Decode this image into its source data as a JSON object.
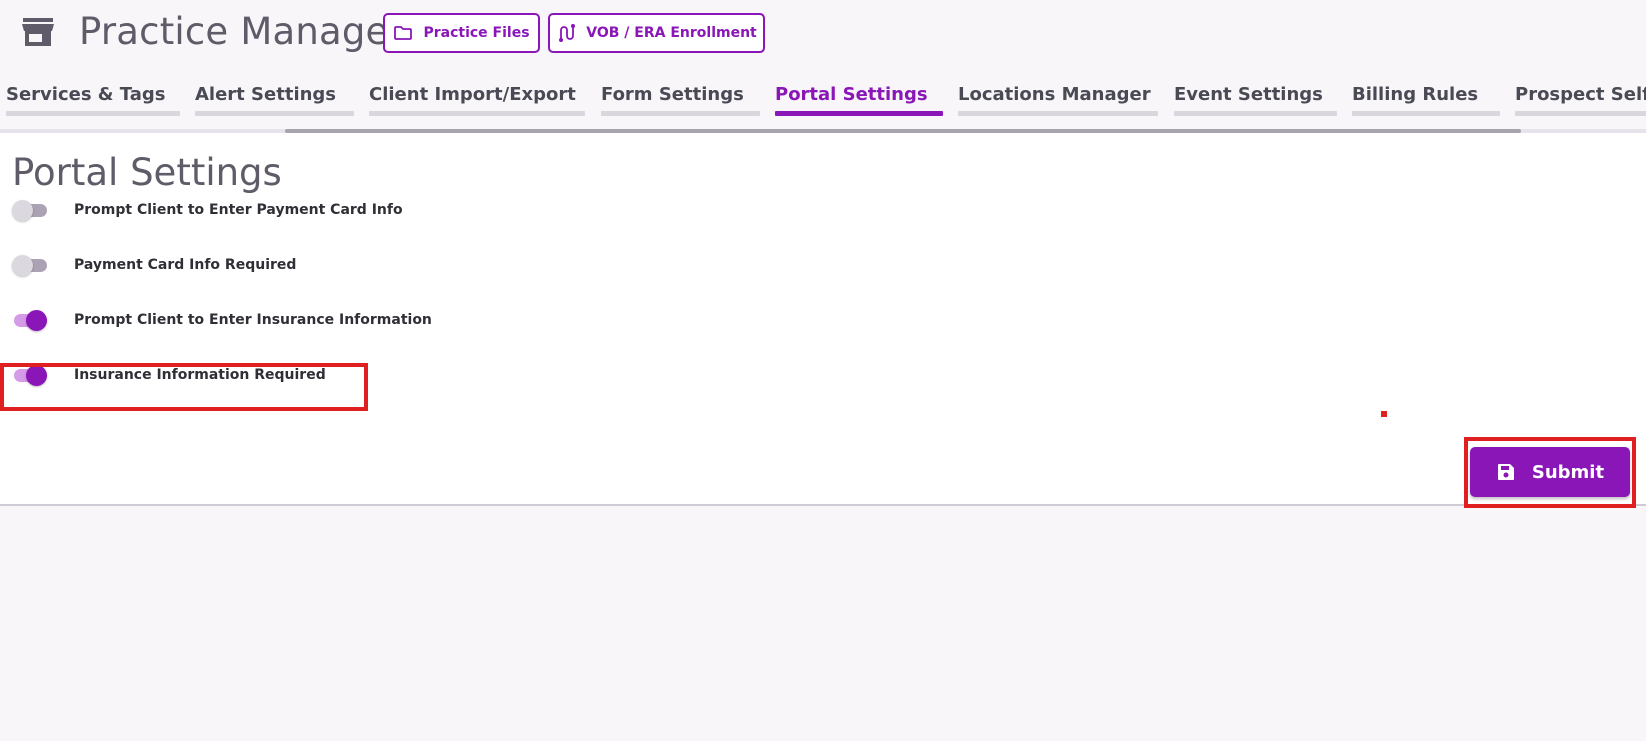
{
  "header": {
    "icon": "store-icon",
    "title": "Practice Manager",
    "buttons": [
      {
        "label": "Practice Files",
        "icon": "folder-icon"
      },
      {
        "label": "VOB / ERA Enrollment",
        "icon": "route-icon"
      }
    ]
  },
  "tabs": {
    "active": "Portal Settings",
    "items": [
      {
        "label": "Services & Tags"
      },
      {
        "label": "Alert Settings"
      },
      {
        "label": "Client Import/Export"
      },
      {
        "label": "Form Settings"
      },
      {
        "label": "Portal Settings"
      },
      {
        "label": "Locations Manager"
      },
      {
        "label": "Event Settings"
      },
      {
        "label": "Billing Rules"
      },
      {
        "label": "Prospect Self S"
      }
    ]
  },
  "main": {
    "title": "Portal Settings",
    "settings": [
      {
        "label": "Prompt Client to Enter Payment Card Info",
        "on": false
      },
      {
        "label": "Payment Card Info Required",
        "on": false
      },
      {
        "label": "Prompt Client to Enter Insurance Information",
        "on": true
      },
      {
        "label": "Insurance Information Required",
        "on": true
      }
    ],
    "submit_label": "Submit",
    "submit_icon": "save-icon"
  },
  "colors": {
    "accent": "#8a16b8",
    "highlight": "#e02020",
    "background": "#f8f6f9"
  }
}
